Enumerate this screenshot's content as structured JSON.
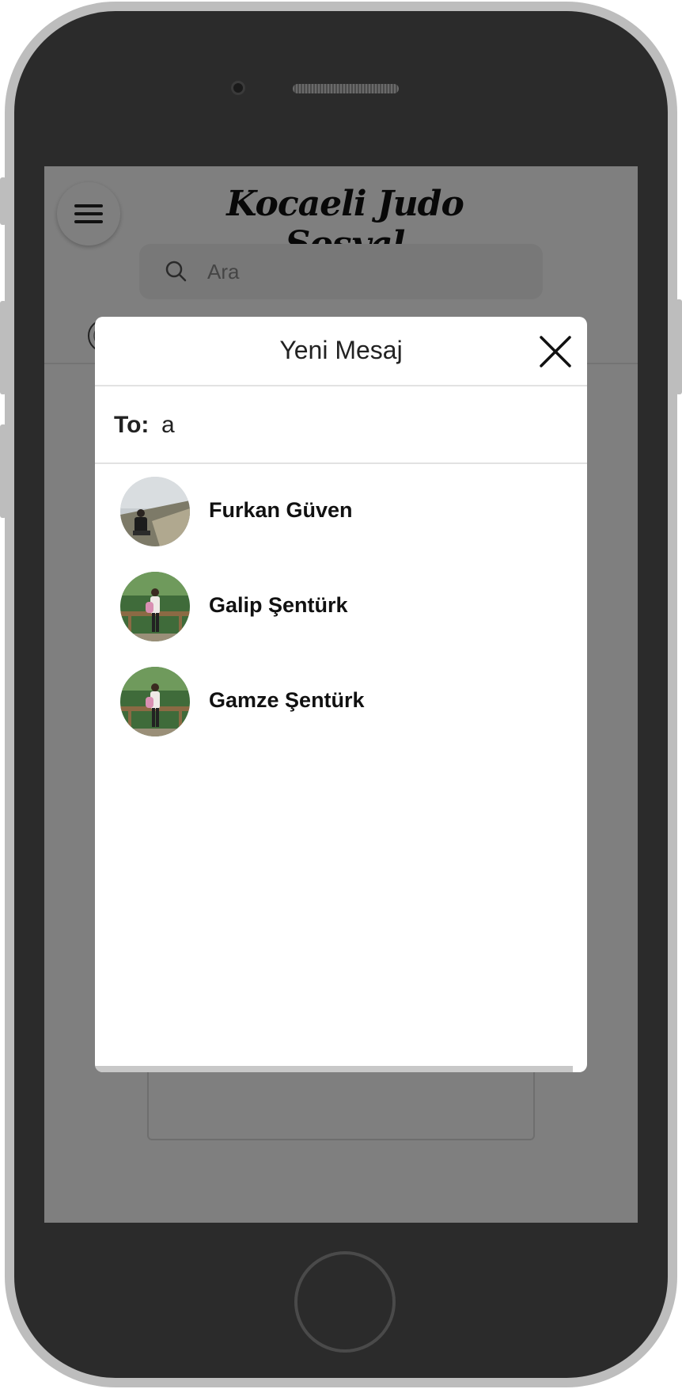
{
  "app": {
    "brand": "Kocaeli Judo Sosyal",
    "search_placeholder": "Ara"
  },
  "icons": {
    "menu": "hamburger-menu-icon",
    "search": "search-icon",
    "close": "close-icon"
  },
  "modal": {
    "title": "Yeni Mesaj",
    "to_label": "To:",
    "to_value": "a",
    "results": [
      {
        "name": "Furkan Güven"
      },
      {
        "name": "Galip Şentürk"
      },
      {
        "name": "Gamze Şentürk"
      }
    ]
  },
  "colors": {
    "overlay": "#000000",
    "modal_bg": "#ffffff",
    "phone_frame": "#2b2b2b"
  }
}
